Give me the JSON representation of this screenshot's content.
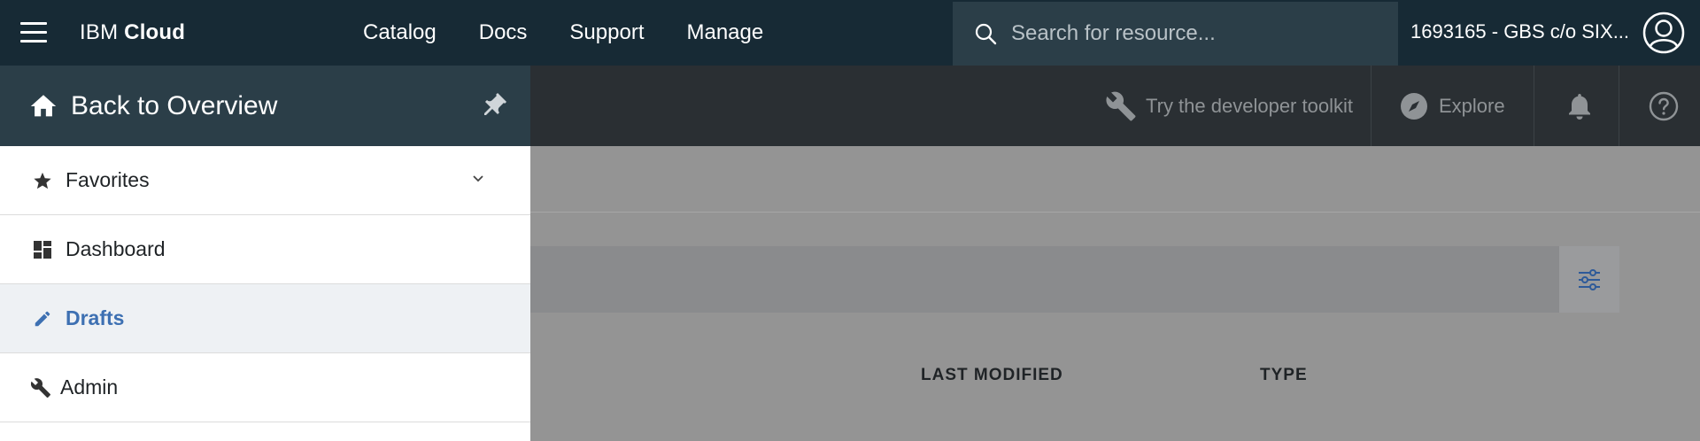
{
  "header": {
    "brand_prefix": "IBM",
    "brand_bold": "Cloud",
    "nav": [
      "Catalog",
      "Docs",
      "Support",
      "Manage"
    ],
    "search_placeholder": "Search for resource...",
    "account": "1693165 - GBS c/o SIX..."
  },
  "subbar": {
    "toolkit": "Try the developer toolkit",
    "explore": "Explore"
  },
  "sidebar": {
    "back_label": "Back to Overview",
    "items": [
      {
        "label": "Favorites",
        "icon": "star-icon"
      },
      {
        "label": "Dashboard",
        "icon": "dashboard-icon"
      },
      {
        "label": "Drafts",
        "icon": "pencil-icon",
        "active": true
      },
      {
        "label": "Admin",
        "icon": "wrench-icon"
      }
    ]
  },
  "table": {
    "columns": [
      "LAST MODIFIED",
      "TYPE"
    ]
  },
  "colors": {
    "topbar": "#172a35",
    "sidebar_header": "#2b3e48",
    "active_item": "#3d70b2",
    "overlay": "#949494"
  }
}
